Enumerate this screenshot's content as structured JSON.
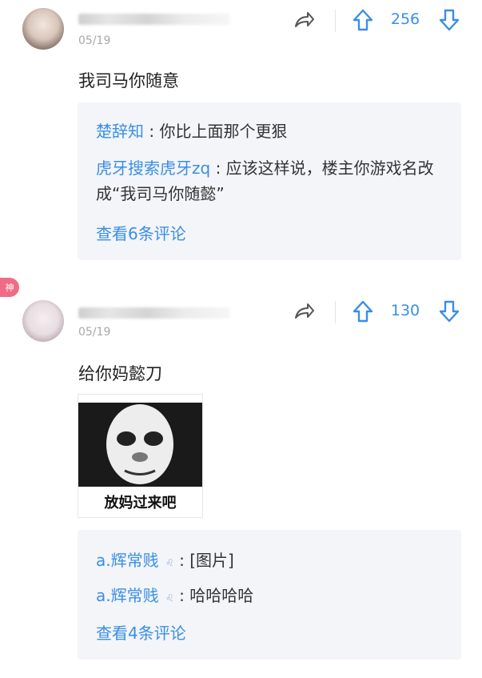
{
  "comments": [
    {
      "date": "05/19",
      "body": "我司马你随意",
      "votes": "256",
      "replies": [
        {
          "name": "楚辞知",
          "sep": ":",
          "text": "你比上面那个更狠"
        },
        {
          "name": "虎牙搜索虎牙zq",
          "sep": ":",
          "text": "应该这样说，楼主你游戏名改成“我司马你随懿”"
        }
      ],
      "more": "查看6条评论"
    },
    {
      "badge": "神",
      "date": "05/19",
      "body": "给你妈懿刀",
      "votes": "130",
      "image_caption": "放妈过来吧",
      "replies": [
        {
          "name": "a.辉常贱",
          "sep": ":",
          "text": "[图片]"
        },
        {
          "name": "a.辉常贱",
          "sep": ":",
          "text": "哈哈哈哈"
        }
      ],
      "more": "查看4条评论"
    }
  ],
  "icons": {
    "share": "share-icon",
    "upvote": "arrow-up-icon",
    "downvote": "arrow-down-icon",
    "badge": "lion-badge-icon"
  },
  "colors": {
    "accent": "#3a8ee6",
    "reply_bg": "#f3f5f8",
    "badge": "#f06c86"
  }
}
